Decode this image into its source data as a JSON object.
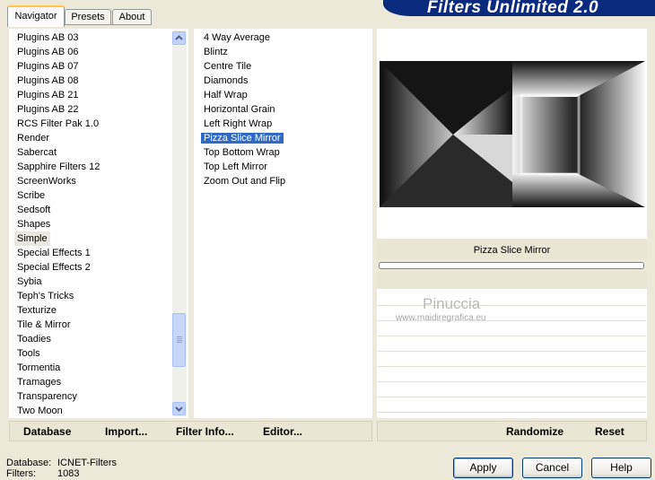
{
  "app": {
    "title": "Filters Unlimited 2.0"
  },
  "tabs": [
    {
      "label": "Navigator",
      "active": true
    },
    {
      "label": "Presets",
      "active": false
    },
    {
      "label": "About",
      "active": false
    }
  ],
  "categories": {
    "items": [
      "Plugins AB 03",
      "Plugins AB 06",
      "Plugins AB 07",
      "Plugins AB 08",
      "Plugins AB 21",
      "Plugins AB 22",
      "RCS Filter Pak 1.0",
      "Render",
      "Sabercat",
      "Sapphire Filters 12",
      "ScreenWorks",
      "Scribe",
      "Sedsoft",
      "Shapes",
      "Simple",
      "Special Effects 1",
      "Special Effects 2",
      "Sybia",
      "Teph's Tricks",
      "Texturize",
      "Tile & Mirror",
      "Toadies",
      "Tools",
      "Tormentia",
      "Tramages",
      "Transparency",
      "Two Moon"
    ],
    "current": "Simple"
  },
  "filters": {
    "items": [
      "4 Way Average",
      "Blintz",
      "Centre Tile",
      "Diamonds",
      "Half Wrap",
      "Horizontal Grain",
      "Left Right Wrap",
      "Pizza Slice Mirror",
      "Top Bottom Wrap",
      "Top Left Mirror",
      "Zoom Out and Flip"
    ],
    "selected": "Pizza Slice Mirror"
  },
  "preview": {
    "filter_name": "Pizza Slice Mirror",
    "watermark_name": "Pinuccia",
    "watermark_url": "www.maidiregrafica.eu"
  },
  "bottom_bar": {
    "database": "Database",
    "import": "Import...",
    "filter_info": "Filter Info...",
    "editor": "Editor...",
    "randomize": "Randomize",
    "reset": "Reset"
  },
  "status": {
    "database_label": "Database:",
    "database_value": "ICNET-Filters",
    "filters_label": "Filters:",
    "filters_value": "1083"
  },
  "buttons": {
    "apply": "Apply",
    "cancel": "Cancel",
    "help": "Help"
  },
  "colors": {
    "selection": "#316ac5",
    "banner": "#0a2a7d",
    "tab_highlight": "#ffc83c"
  }
}
